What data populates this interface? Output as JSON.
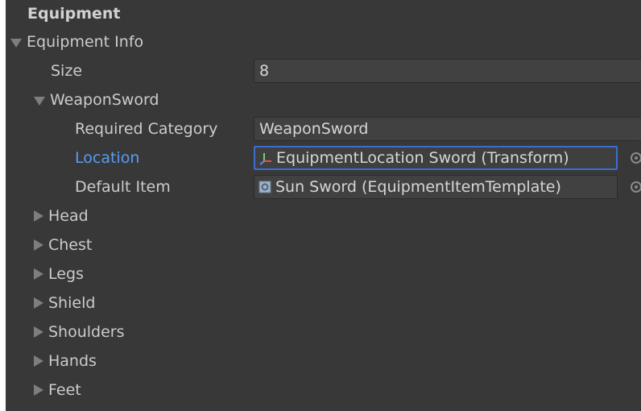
{
  "header": {
    "title": "Equipment"
  },
  "equipment_info": {
    "label": "Equipment Info",
    "size_label": "Size",
    "size_value": "8",
    "weapon_sword": {
      "label": "WeaponSword",
      "required_category_label": "Required Category",
      "required_category_value": "WeaponSword",
      "location_label": "Location",
      "location_value": "EquipmentLocation Sword (Transform)",
      "location_icon": "transform-axes-icon",
      "default_item_label": "Default Item",
      "default_item_value": "Sun Sword (EquipmentItemTemplate)",
      "default_item_icon": "scriptable-object-icon"
    },
    "collapsed_items": [
      "Head",
      "Chest",
      "Legs",
      "Shield",
      "Shoulders",
      "Hands",
      "Feet"
    ]
  },
  "colors": {
    "panel_bg": "#383838",
    "text": "#cbcbcb",
    "focused_label": "#5a9cf0",
    "focus_border": "#3a6fcf"
  }
}
